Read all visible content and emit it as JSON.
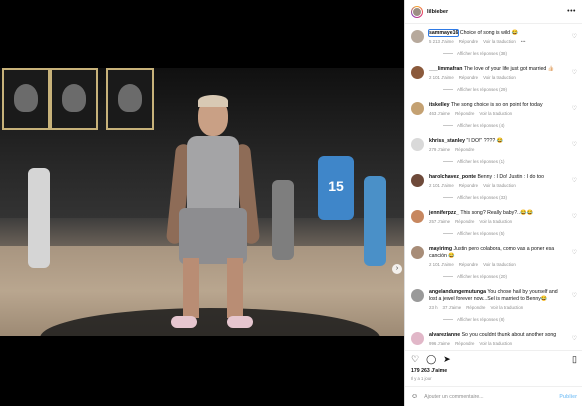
{
  "post": {
    "username": "lilbieber",
    "more_icon": "more-horizontal-icon"
  },
  "comments": [
    {
      "user": "sammaye16",
      "text": " Choice of song is wild 😂",
      "likes": "5 213 J'aime",
      "reply": "Répondre",
      "translate": "Voir la traduction",
      "more": "•••",
      "replies": "Afficher les réponses (38)",
      "avatar_color": "#b7a99c"
    },
    {
      "user": "___limmafran",
      "text": " The love of your life just got married 👍🏻",
      "likes": "2 101 J'aime",
      "reply": "Répondre",
      "translate": "Voir la traduction",
      "replies": "Afficher les réponses (29)",
      "avatar_color": "#8b5a3c"
    },
    {
      "user": "itskelley",
      "text": " The song choice is so on point for today",
      "likes": "463 J'aime",
      "reply": "Répondre",
      "translate": "Voir la traduction",
      "replies": "Afficher les réponses (4)",
      "avatar_color": "#c4a172"
    },
    {
      "user": "khriss_stanley",
      "text": " \"I DO!\" ???? 😂",
      "likes": "279 J'aime",
      "reply": "Répondre",
      "translate": "",
      "replies": "Afficher les réponses (1)",
      "avatar_color": "#d9d9d9"
    },
    {
      "user": "harolchavez_ponte",
      "text": " Benny : I Do!\nJustin : I do too",
      "likes": "2 101 J'aime",
      "reply": "Répondre",
      "translate": "Voir la traduction",
      "replies": "Afficher les réponses (33)",
      "avatar_color": "#6e4a3a"
    },
    {
      "user": "jenniferpzz_",
      "text": " This song? Really baby?..😂😂",
      "likes": "257 J'aime",
      "reply": "Répondre",
      "translate": "Voir la traduction",
      "replies": "Afficher les réponses (5)",
      "avatar_color": "#c7875f"
    },
    {
      "user": "mayirimg",
      "text": " Justin pero colabora, como vas a poner esa canción 😂",
      "likes": "2 101 J'aime",
      "reply": "Répondre",
      "translate": "Voir la traduction",
      "replies": "Afficher les réponses (20)",
      "avatar_color": "#a88d78"
    },
    {
      "user": "angelandungemutunga",
      "text": " You chose hail by yourself and lost a jewel forever now...Sel is married to Benny😂",
      "likes": "37 J'aime",
      "time": "23 h",
      "reply": "Répondre",
      "translate": "Voir la traduction",
      "replies": "Afficher les réponses (8)",
      "avatar_color": "#9a9a9a"
    },
    {
      "user": "alvarezianne",
      "text": " So you couldnt thunk about another song",
      "likes": "996 J'aime",
      "reply": "Répondre",
      "translate": "Voir la traduction",
      "replies": "",
      "avatar_color": "#e1b7c8"
    }
  ],
  "actions": {
    "like_icon": "heart-outline-icon",
    "comment_icon": "comment-icon",
    "share_icon": "send-icon",
    "save_icon": "bookmark-icon"
  },
  "likes_count": "179 263 J'aime",
  "posted_ago": "Il y a 1 jour",
  "add_comment": {
    "placeholder": "Ajouter un commentaire...",
    "post_label": "Publier",
    "emoji_icon": "smiley-icon"
  },
  "colors": {
    "accent": "#0095f6",
    "post_disabled": "#8ecbf8",
    "muted_text": "#8e8e8e"
  }
}
